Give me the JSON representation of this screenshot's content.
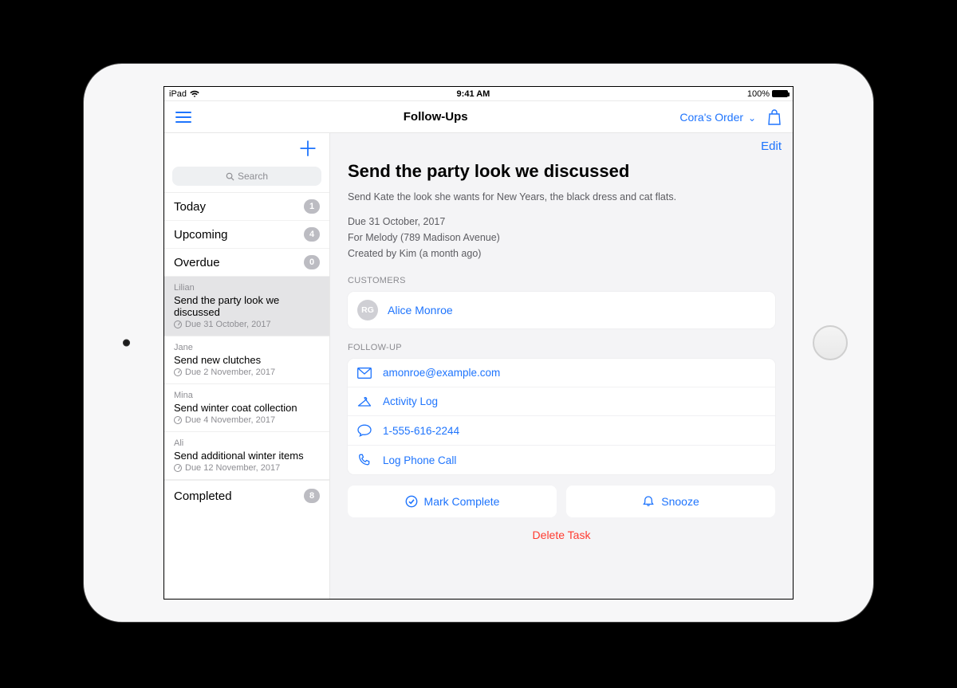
{
  "status": {
    "carrier": "iPad",
    "time": "9:41 AM",
    "battery_label": "100%"
  },
  "nav": {
    "title": "Follow-Ups",
    "order_label": "Cora's Order"
  },
  "sidebar": {
    "search_placeholder": "Search",
    "filters": [
      {
        "label": "Today",
        "count": "1"
      },
      {
        "label": "Upcoming",
        "count": "4"
      },
      {
        "label": "Overdue",
        "count": "0"
      }
    ],
    "tasks": [
      {
        "owner": "Lilian",
        "title": "Send the party look we discussed",
        "due": "Due 31 October, 2017",
        "selected": true
      },
      {
        "owner": "Jane",
        "title": "Send new clutches",
        "due": "Due 2 November, 2017",
        "selected": false
      },
      {
        "owner": "Mina",
        "title": "Send winter coat collection",
        "due": "Due 4 November, 2017",
        "selected": false
      },
      {
        "owner": "Ali",
        "title": "Send additional winter items",
        "due": "Due 12 November, 2017",
        "selected": false
      }
    ],
    "completed_label": "Completed",
    "completed_count": "8"
  },
  "detail": {
    "edit_label": "Edit",
    "title": "Send the party look we discussed",
    "description": "Send Kate the look she wants for New Years, the black dress and cat flats.",
    "meta": {
      "due": "Due 31 October, 2017",
      "for_line": "For Melody (789 Madison Avenue)",
      "created_line": "Created by Kim (a month ago)"
    },
    "customers_label": "CUSTOMERS",
    "customer": {
      "initials": "RG",
      "name": "Alice Monroe"
    },
    "followup_label": "FOLLOW-UP",
    "follow_items": {
      "email": "amonroe@example.com",
      "activity": "Activity Log",
      "phone": "1-555-616-2244",
      "log_call": "Log Phone Call"
    },
    "actions": {
      "complete": "Mark Complete",
      "snooze": "Snooze",
      "delete": "Delete Task"
    }
  }
}
